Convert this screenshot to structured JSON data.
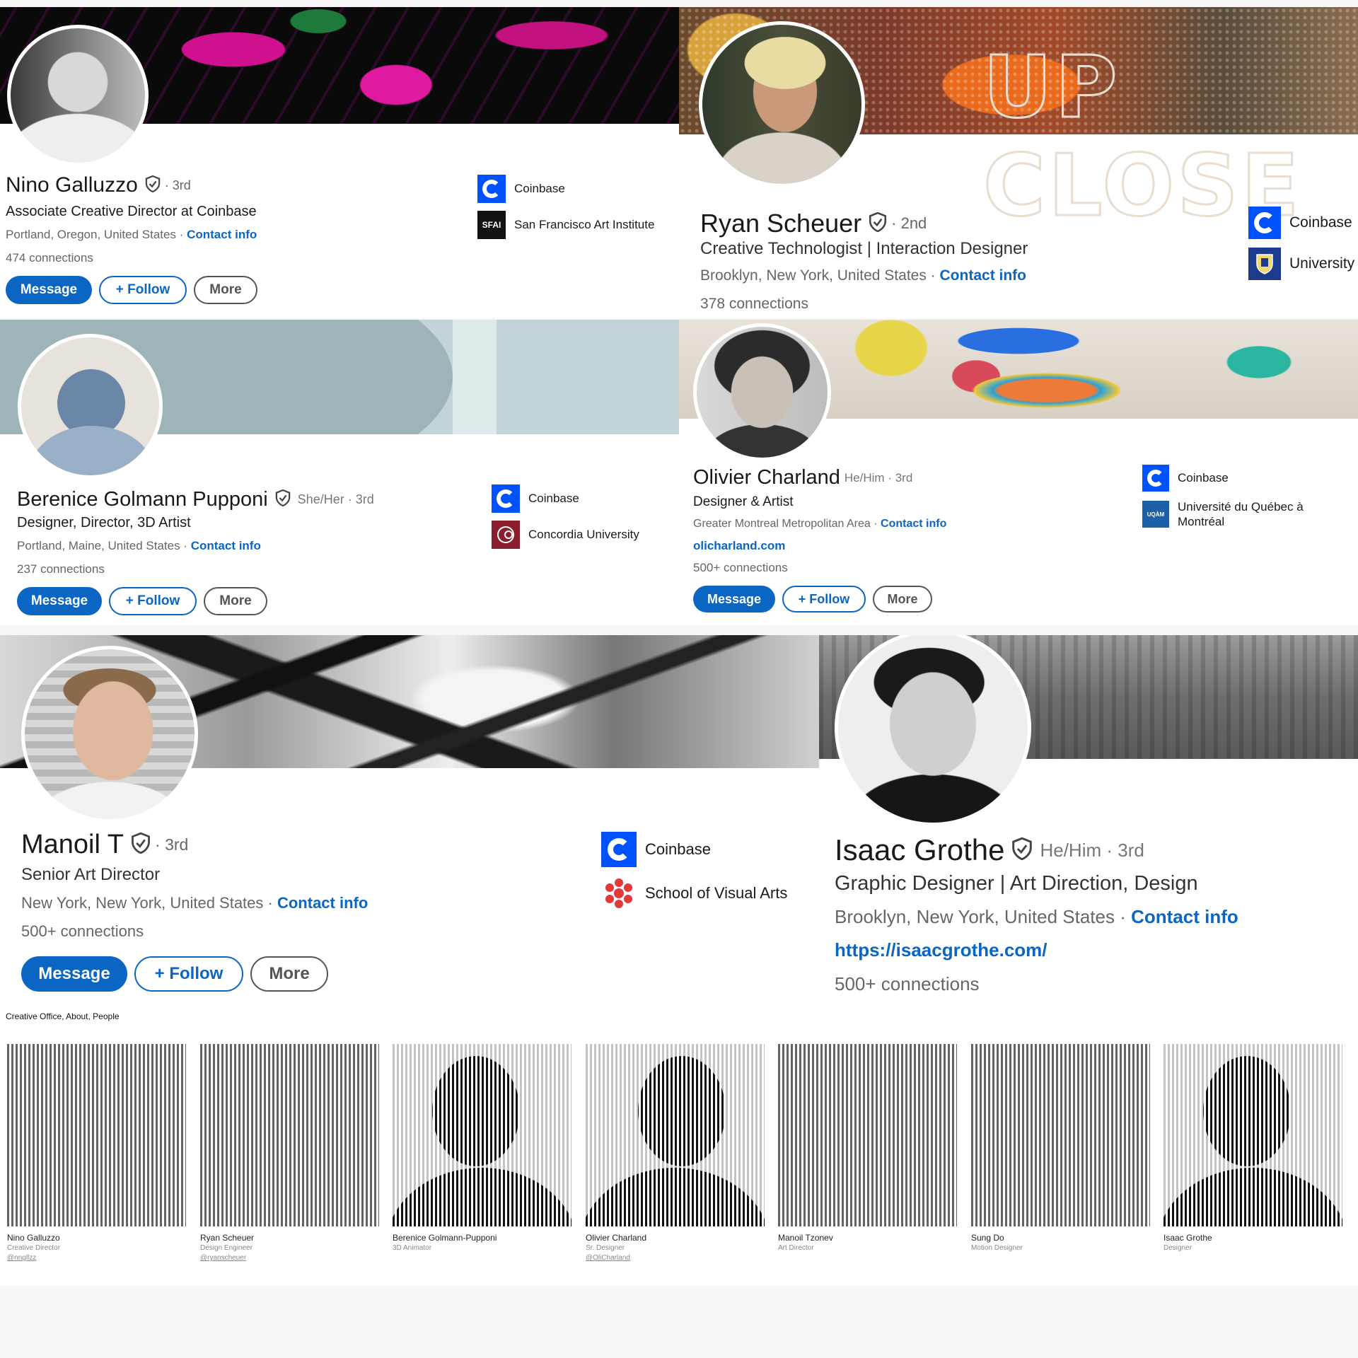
{
  "colors": {
    "accent": "#0a66c2",
    "coinbase": "#0052ff"
  },
  "profiles": {
    "nino": {
      "name": "Nino Galluzzo",
      "degree": "· 3rd",
      "headline": "Associate Creative Director at Coinbase",
      "location": "Portland, Oregon, United States ·",
      "contact": "Contact info",
      "connections": "474 connections",
      "message": "Message",
      "follow": "+ Follow",
      "more": "More",
      "org1": "Coinbase",
      "org2": "San Francisco Art Institute",
      "org2_logo": "SFAI"
    },
    "ryan": {
      "name": "Ryan Scheuer",
      "degree": "· 2nd",
      "headline": "Creative Technologist | Interaction Designer",
      "location": "Brooklyn, New York, United States ·",
      "contact": "Contact info",
      "connections": "378 connections",
      "org1": "Coinbase",
      "org2": "University"
    },
    "berenice": {
      "name": "Berenice Golmann Pupponi",
      "pronouns": "She/Her · 3rd",
      "headline": "Designer, Director, 3D Artist",
      "location": "Portland, Maine, United States ·",
      "contact": "Contact info",
      "connections": "237 connections",
      "message": "Message",
      "follow": "+ Follow",
      "more": "More",
      "org1": "Coinbase",
      "org2": "Concordia University"
    },
    "olivier": {
      "name": "Olivier Charland",
      "pronouns": "He/Him · 3rd",
      "headline": "Designer & Artist",
      "location": "Greater Montreal Metropolitan Area ·",
      "contact": "Contact info",
      "website": "olicharland.com",
      "connections": "500+ connections",
      "message": "Message",
      "follow": "+ Follow",
      "more": "More",
      "org1": "Coinbase",
      "org2_line1": "Université du Québec à",
      "org2_line2": "Montréal",
      "org2_logo": "UQÀM"
    },
    "manoil": {
      "name": "Manoil T",
      "degree": "· 3rd",
      "headline": "Senior Art Director",
      "location": "New York, New York, United States ·",
      "contact": "Contact info",
      "connections": "500+ connections",
      "message": "Message",
      "follow": "+ Follow",
      "more": "More",
      "org1": "Coinbase",
      "org2": "School of Visual Arts"
    },
    "isaac": {
      "name": "Isaac Grothe",
      "pronouns": "He/Him · 3rd",
      "headline": "Graphic Designer | Art Direction, Design",
      "location": "Brooklyn, New York, United States ·",
      "contact": "Contact info",
      "website": "https://isaacgrothe.com/",
      "connections": "500+ connections"
    }
  },
  "gallery": {
    "caption": "Creative Office, About, People",
    "people": [
      {
        "name": "Nino Galluzzo",
        "role": "Creative Director",
        "handle": "@nngllzz"
      },
      {
        "name": "Ryan Scheuer",
        "role": "Design Engineer",
        "handle": "@ryanscheuer"
      },
      {
        "name": "Berenice Golmann-Pupponi",
        "role": "3D Animator",
        "handle": ""
      },
      {
        "name": "Olivier Charland",
        "role": "Sr. Designer",
        "handle": "@OliCharland"
      },
      {
        "name": "Manoil Tzonev",
        "role": "Art Director",
        "handle": ""
      },
      {
        "name": "Sung Do",
        "role": "Motion Designer",
        "handle": ""
      },
      {
        "name": "Isaac Grothe",
        "role": "Designer",
        "handle": ""
      }
    ]
  }
}
